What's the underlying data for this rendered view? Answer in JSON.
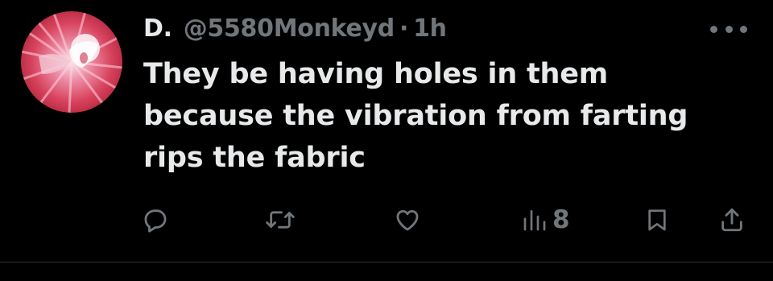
{
  "tweet": {
    "display_name": "D.",
    "handle": "@5580Monkeyd",
    "separator": "·",
    "time": "1h",
    "text": "They be having holes in them because the vibration from farting rips the fabric",
    "views": "8"
  },
  "icons": {
    "more": "more-dots-icon",
    "reply": "reply-icon",
    "retweet": "retweet-icon",
    "like": "heart-icon",
    "views": "views-bar-icon",
    "bookmark": "bookmark-icon",
    "share": "share-icon"
  },
  "colors": {
    "background": "#000000",
    "text": "#e7e9ea",
    "muted": "#71767b",
    "divider": "#2f3336"
  }
}
